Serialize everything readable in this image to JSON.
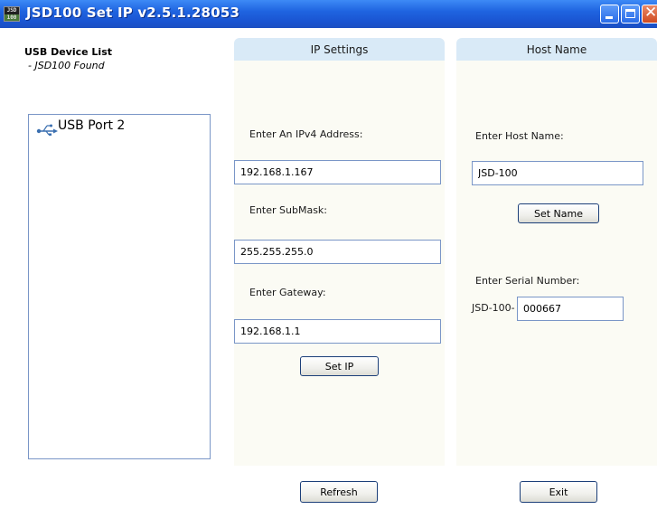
{
  "window": {
    "title": "JSD100 Set IP v2.5.1.28053",
    "icon_text_top": "JSD",
    "icon_text_bottom": "100"
  },
  "device_list": {
    "heading": "USB Device List",
    "status": "- JSD100 Found",
    "items": [
      {
        "label": "USB Port 2",
        "icon": "usb-icon"
      }
    ]
  },
  "ip_settings": {
    "header": "IP Settings",
    "ipv4_label": "Enter An IPv4 Address:",
    "ipv4_value": "192.168.1.167",
    "submask_label": "Enter SubMask:",
    "submask_value": "255.255.255.0",
    "gateway_label": "Enter Gateway:",
    "gateway_value": "192.168.1.1",
    "set_ip_label": "Set IP"
  },
  "host_name": {
    "header": "Host Name",
    "host_label": "Enter Host Name:",
    "host_value": "JSD-100",
    "set_name_label": "Set Name",
    "serial_label": "Enter Serial Number:",
    "serial_prefix": "JSD-100-",
    "serial_value": "000667"
  },
  "footer": {
    "refresh_label": "Refresh",
    "exit_label": "Exit"
  },
  "colors": {
    "titlebar": "#1f64e0",
    "panel_header": "#d9eaf7",
    "panel_body": "#fbfbf4",
    "field_border": "#7a96c7"
  }
}
